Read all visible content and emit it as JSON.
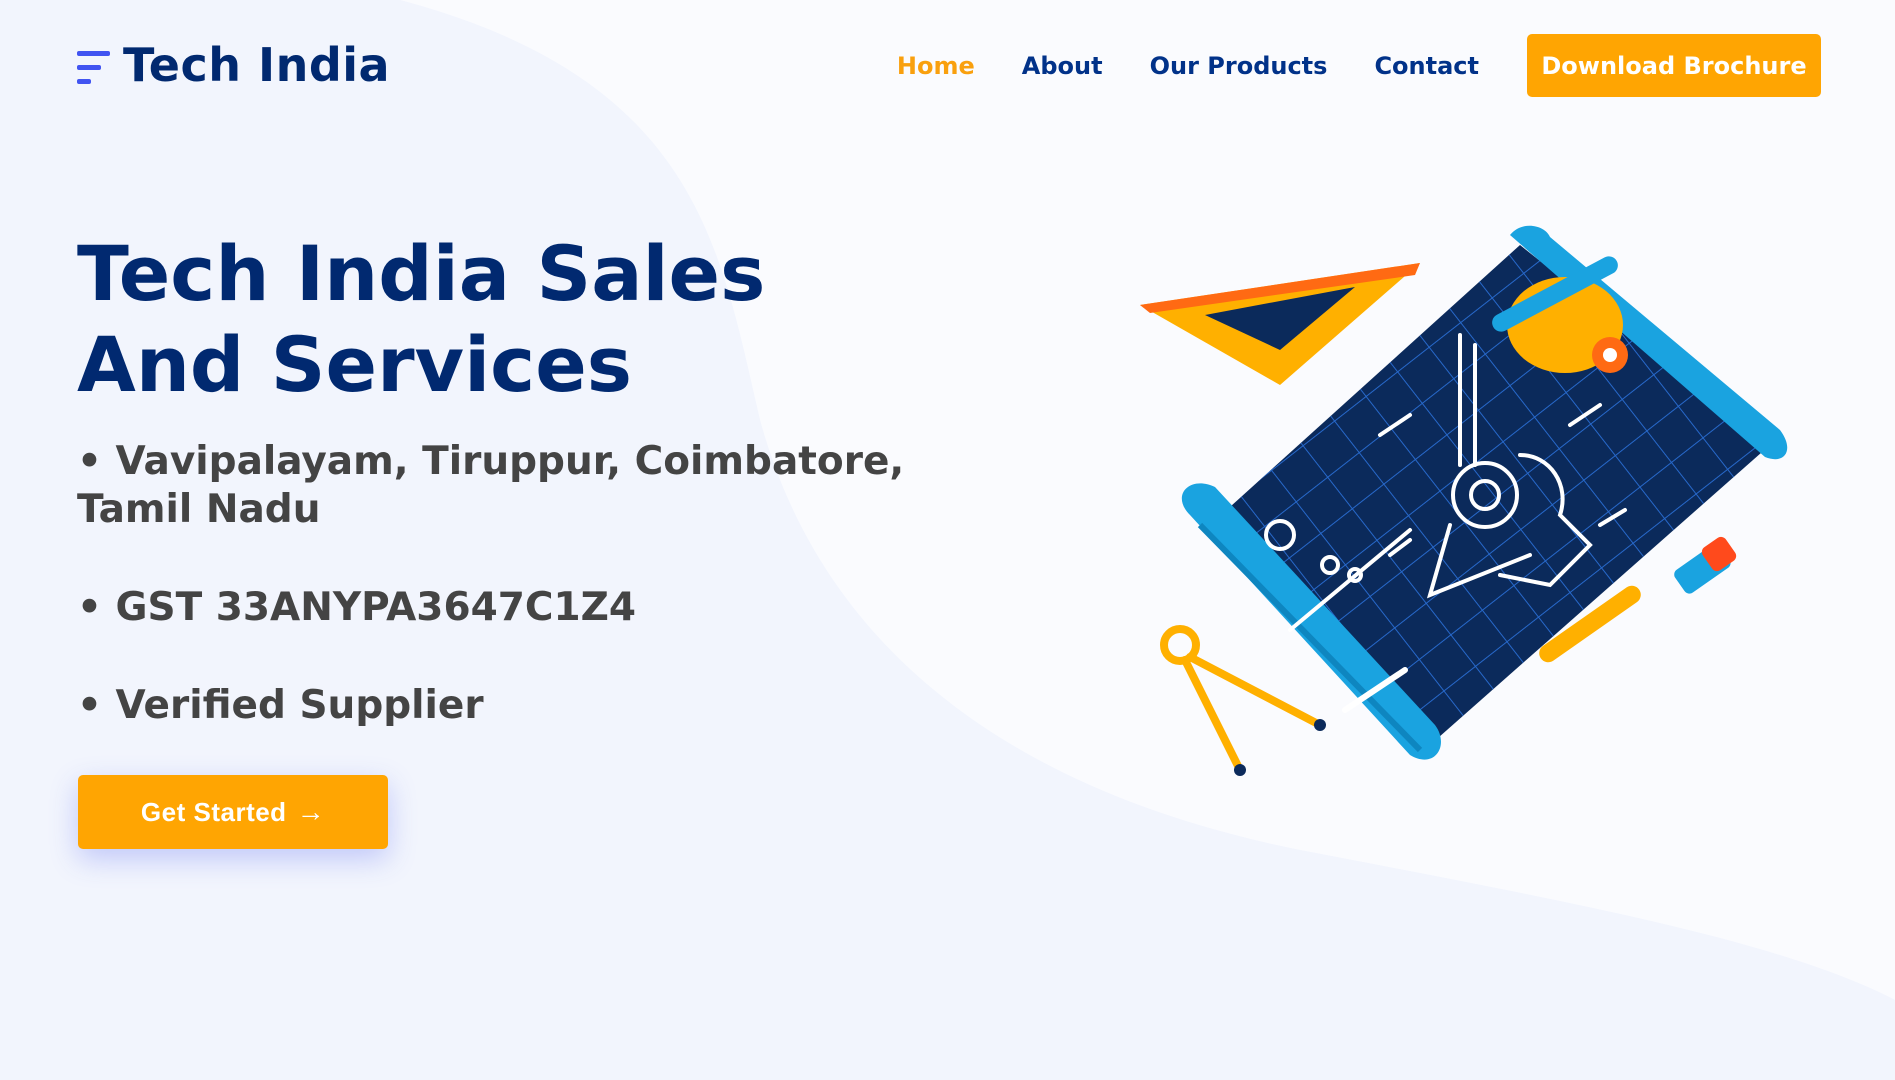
{
  "brand": {
    "name": "Tech India",
    "icon": "menu-lines-icon",
    "color": "#4154f1"
  },
  "nav": {
    "items": [
      {
        "label": "Home",
        "active": true
      },
      {
        "label": "About",
        "active": false
      },
      {
        "label": "Our Products",
        "active": false
      },
      {
        "label": "Contact",
        "active": false
      }
    ],
    "cta_label": "Download Brochure"
  },
  "hero": {
    "title": "Tech India Sales And Services",
    "bullets": [
      "• Vavipalayam, Tiruppur, Coimbatore, Tamil Nadu",
      "• GST 33ANYPA3647C1Z4",
      "• Verified Supplier"
    ],
    "cta_label": "Get Started",
    "cta_icon": "arrow-right-icon"
  },
  "colors": {
    "accent": "#ffa502",
    "heading": "#012970",
    "nav_text": "#013289",
    "active_nav": "#f9a00e",
    "body_text": "#444444",
    "background": "#f2f5fd"
  }
}
